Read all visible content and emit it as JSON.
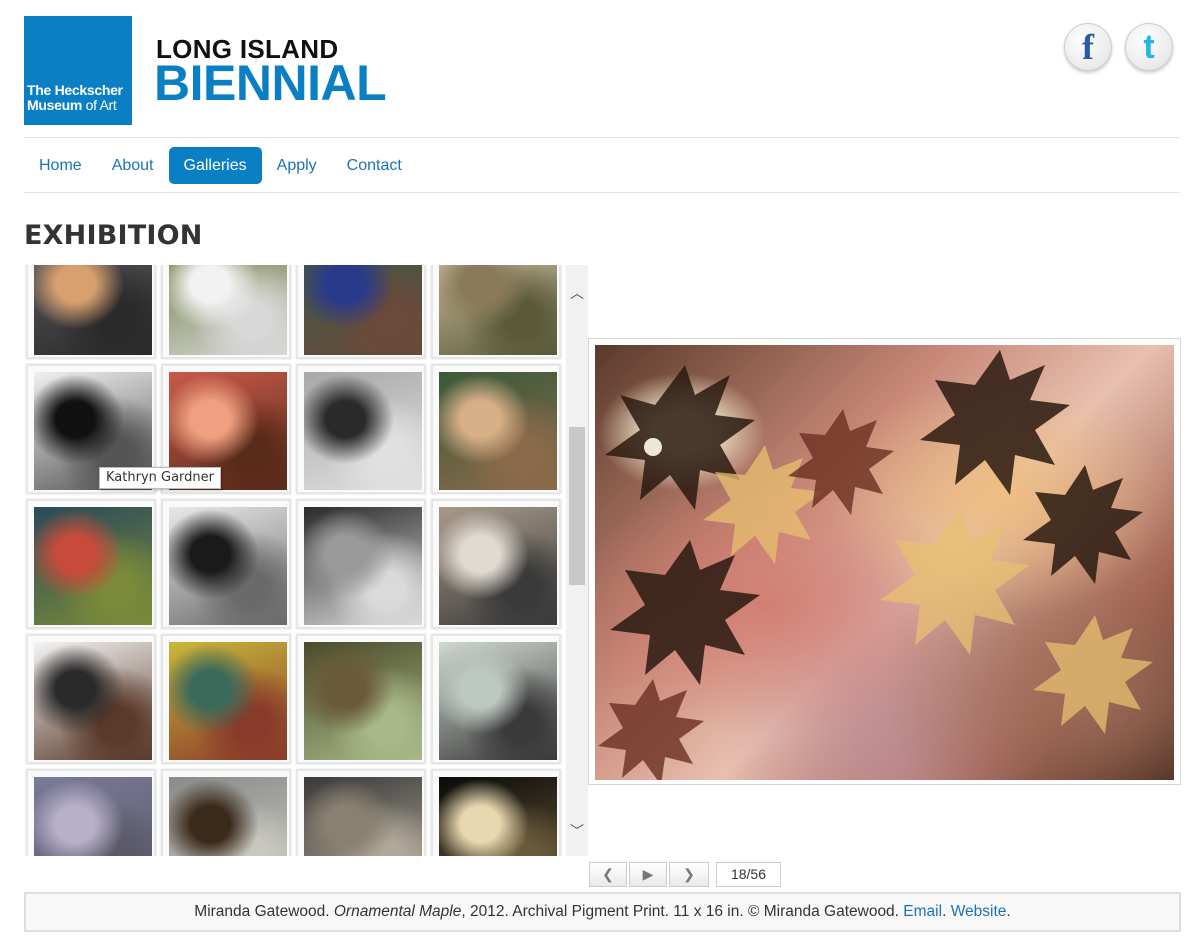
{
  "logo": {
    "museum_line1_bold": "The Heckscher",
    "museum_line2_bold": "Museum",
    "museum_line2_rest": " of Art",
    "brand_top": "LONG ISLAND",
    "brand_bottom": "BIENNIAL"
  },
  "social": {
    "facebook_glyph": "f",
    "twitter_glyph": "t"
  },
  "nav": {
    "items": [
      {
        "label": "Home",
        "active": false
      },
      {
        "label": "About",
        "active": false
      },
      {
        "label": "Galleries",
        "active": true
      },
      {
        "label": "Apply",
        "active": false
      },
      {
        "label": "Contact",
        "active": false
      }
    ]
  },
  "section_title": "EXHIBITION",
  "gallery": {
    "thumbnails": [
      {
        "colors": [
          "#5a5a60",
          "#d8a070",
          "#2a2a2a"
        ]
      },
      {
        "colors": [
          "#6a7a3a",
          "#f2f2f2",
          "#d8d8d8"
        ]
      },
      {
        "colors": [
          "#3a5a4a",
          "#2a3a8a",
          "#6a4a3a"
        ]
      },
      {
        "colors": [
          "#d8c8a8",
          "#8a7a5a",
          "#5a5a3a"
        ]
      },
      {
        "colors": [
          "#f0f0f0",
          "#111111",
          "#555555"
        ]
      },
      {
        "colors": [
          "#c85a4a",
          "#f0a080",
          "#5a2a1a"
        ]
      },
      {
        "colors": [
          "#a8a8a8",
          "#2a2a2a",
          "#e0e0e0"
        ]
      },
      {
        "colors": [
          "#3a5a3a",
          "#d8b088",
          "#8a6a4a"
        ]
      },
      {
        "colors": [
          "#2a4a5a",
          "#c84a3a",
          "#7a8a3a"
        ]
      },
      {
        "colors": [
          "#e8e8e8",
          "#1a1a1a",
          "#6a6a6a"
        ]
      },
      {
        "colors": [
          "#2a2a2a",
          "#9a9a9a",
          "#dadada"
        ]
      },
      {
        "colors": [
          "#a89a8a",
          "#e0dad0",
          "#3a3a3a"
        ]
      },
      {
        "colors": [
          "#f4f4f4",
          "#2a2a2a",
          "#5a3a2a"
        ]
      },
      {
        "colors": [
          "#c8b83a",
          "#3a6a5a",
          "#8a3a2a"
        ]
      },
      {
        "colors": [
          "#4a4a2a",
          "#6a5a3a",
          "#a8b888"
        ]
      },
      {
        "colors": [
          "#d0d8d0",
          "#bcc8c0",
          "#3a3a3a"
        ]
      },
      {
        "colors": [
          "#7a7a9a",
          "#b8b0c8",
          "#5a5a6a"
        ]
      },
      {
        "colors": [
          "#8a8a88",
          "#3a2a1a",
          "#c8c8c0"
        ]
      },
      {
        "colors": [
          "#3a3a3a",
          "#8a8070",
          "#b0a898"
        ]
      },
      {
        "colors": [
          "#0a0a0a",
          "#e8d8b0",
          "#6a5a3a"
        ]
      }
    ],
    "tooltip": "Kathryn Gardner"
  },
  "controls": {
    "prev_glyph": "❮",
    "play_glyph": "▶",
    "next_glyph": "❯",
    "counter": "18/56"
  },
  "caption": {
    "artist": "Miranda Gatewood. ",
    "title": "Ornamental Maple",
    "details": ", 2012. Archival Pigment Print. 11 x 16 in. © Miranda Gatewood. ",
    "email_link": "Email",
    "sep": ". ",
    "website_link": "Website",
    "end": "."
  }
}
